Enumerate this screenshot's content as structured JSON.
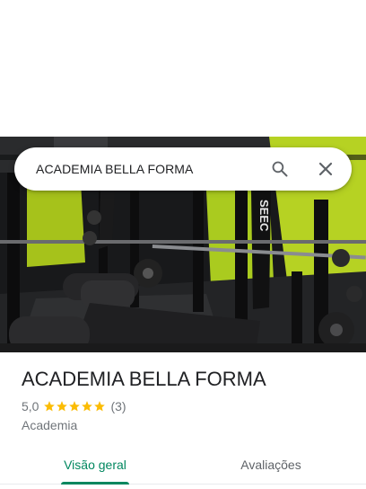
{
  "search": {
    "query": "ACADEMIA BELLA FORMA"
  },
  "hero": {
    "image_alt": "Academia gym interior",
    "banner_text": "SEEC"
  },
  "place": {
    "name": "ACADEMIA BELLA FORMA",
    "rating": "5,0",
    "stars": 5,
    "review_count": "(3)",
    "category": "Academia"
  },
  "tabs": [
    {
      "label": "Visão geral",
      "active": true
    },
    {
      "label": "Avaliações",
      "active": false
    }
  ],
  "colors": {
    "accent": "#01875f",
    "star": "#fbbc04",
    "wall": "#b6d223",
    "secondary_text": "#70757a"
  },
  "icons": {
    "search": "search-icon",
    "close": "close-icon",
    "star": "star-icon"
  }
}
